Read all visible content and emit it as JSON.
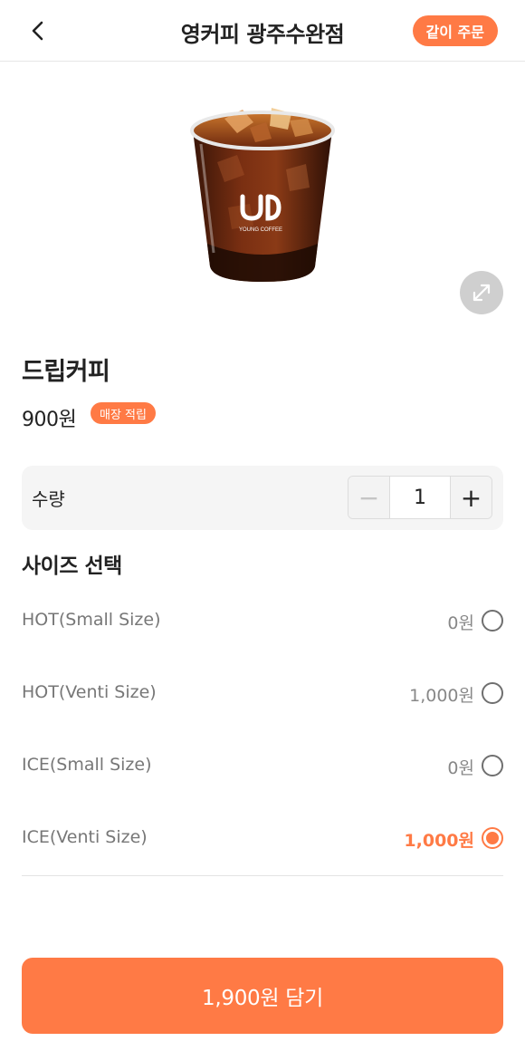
{
  "header": {
    "title": "영커피 광주수완점",
    "group_order_label": "같이 주문"
  },
  "product": {
    "image_icon": "iced-coffee-cup-image",
    "logo_text": "YOUNG COFFEE",
    "name": "드립커피",
    "price": "900원",
    "badge": "매장 적립"
  },
  "quantity": {
    "label": "수량",
    "value": "1",
    "minus": "−",
    "plus": "+"
  },
  "size_section": {
    "title": "사이즈 선택",
    "options": [
      {
        "name": "HOT(Small Size)",
        "price": "0원",
        "selected": false
      },
      {
        "name": "HOT(Venti Size)",
        "price": "1,000원",
        "selected": false
      },
      {
        "name": "ICE(Small Size)",
        "price": "0원",
        "selected": false
      },
      {
        "name": "ICE(Venti Size)",
        "price": "1,000원",
        "selected": true
      }
    ]
  },
  "cart_button": {
    "label": "1,900원 담기"
  },
  "colors": {
    "accent": "#ff7a45",
    "text": "#222222",
    "muted": "#777777",
    "panel": "#f5f5f5"
  }
}
